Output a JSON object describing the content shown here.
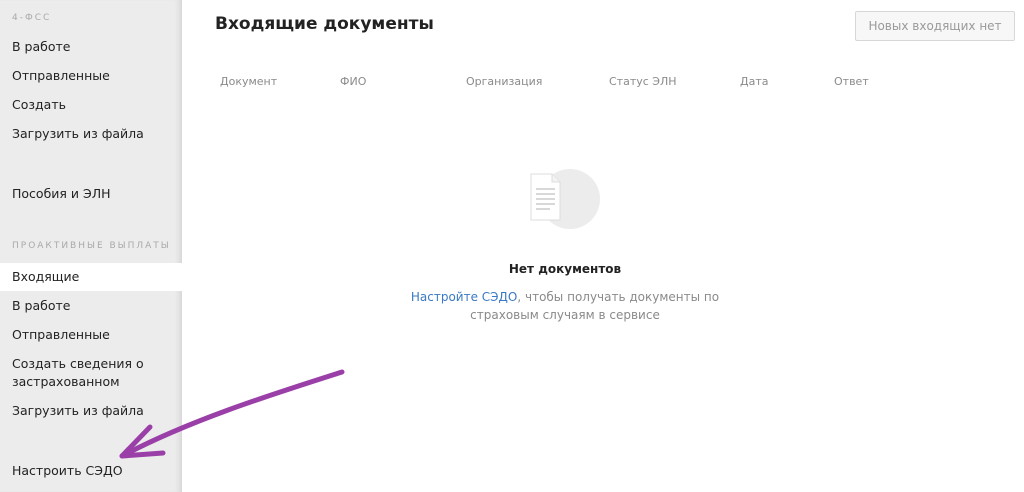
{
  "sidebar": {
    "section1": "4-ФСС",
    "items1": [
      "В работе",
      "Отправленные",
      "Создать",
      "Загрузить из файла"
    ],
    "benefits": "Пособия и ЭЛН",
    "section2": "ПРОАКТИВНЫЕ ВЫПЛАТЫ",
    "items2": [
      "Входящие",
      "В работе",
      "Отправленные",
      "Создать сведения о",
      "застрахованном",
      "Загрузить из файла"
    ],
    "sedo": "Настроить СЭДО"
  },
  "main": {
    "title": "Входящие документы",
    "new_button": "Новых входящих нет",
    "columns": [
      "Документ",
      "ФИО",
      "Организация",
      "Статус ЭЛН",
      "Дата",
      "Ответ"
    ],
    "empty": {
      "title": "Нет документов",
      "link": "Настройте СЭДО",
      "text": ", чтобы получать документы по страховым случаям в сервисе"
    }
  },
  "colors": {
    "accent_link": "#3a79c4",
    "arrow": "#9b3fa8",
    "sidebar_bg": "#ececec"
  }
}
